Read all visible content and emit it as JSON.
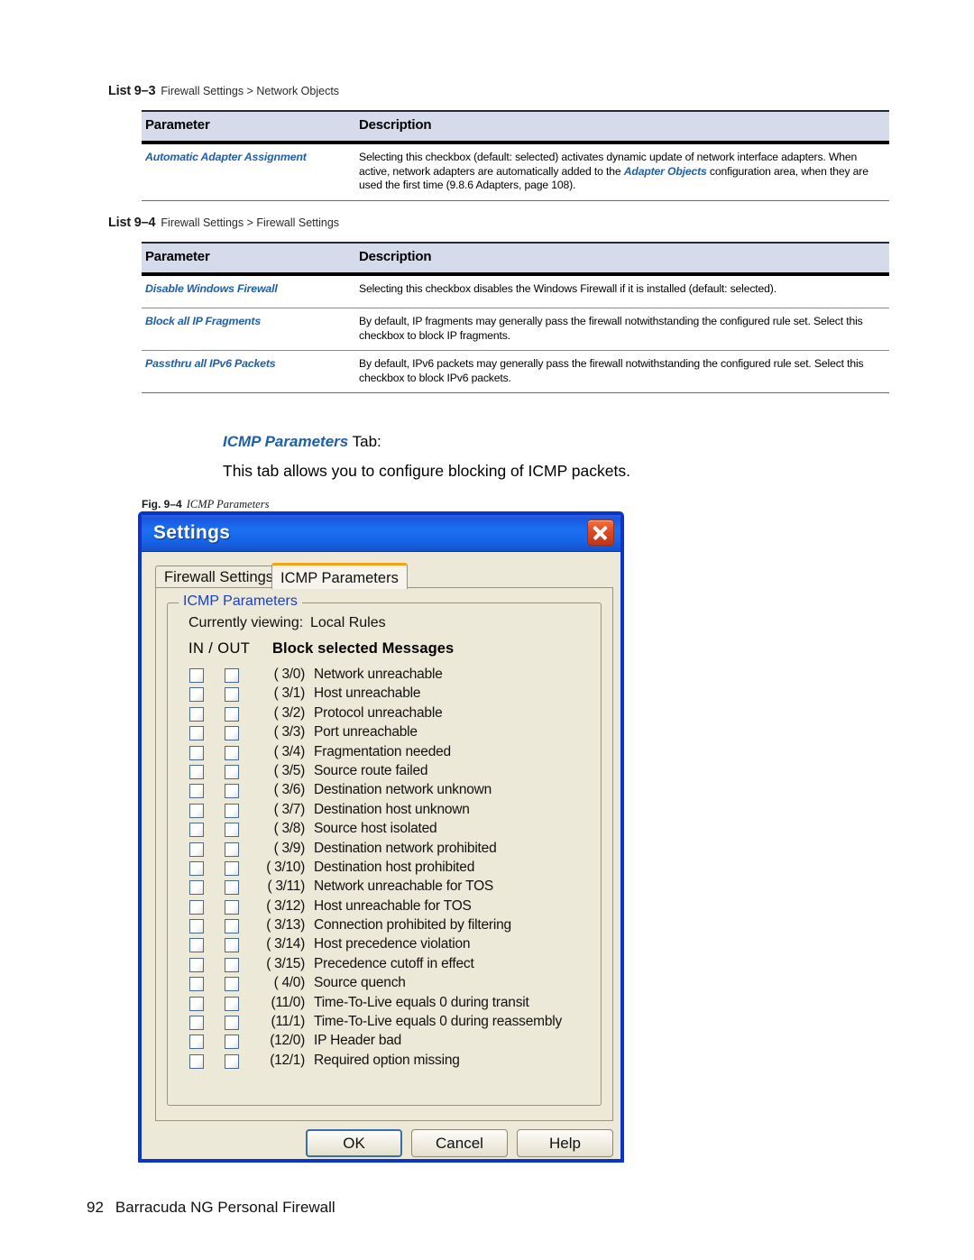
{
  "page": {
    "footer_page_number": "92",
    "footer_title": "Barracuda NG Personal Firewall"
  },
  "lists": [
    {
      "label": "List 9–3",
      "breadcrumb": "Firewall Settings > Network Objects",
      "headers": {
        "parameter": "Parameter",
        "description": "Description"
      },
      "rows": [
        {
          "parameter": "Automatic Adapter Assignment",
          "description_html": "Selecting this checkbox (default: selected) activates dynamic update of network interface adapters. When active, network adapters are automatically added to the <b class=\"blue\">Adapter Objects</b> configuration area, when they are used the first time (9.8.6 Adapters, page 108)."
        }
      ]
    },
    {
      "label": "List 9–4",
      "breadcrumb": "Firewall Settings > Firewall Settings",
      "headers": {
        "parameter": "Parameter",
        "description": "Description"
      },
      "rows": [
        {
          "parameter": "Disable Windows Firewall",
          "description_html": "Selecting this checkbox disables the Windows Firewall if it is installed (default: selected)."
        },
        {
          "parameter": "Block all IP Fragments",
          "description_html": "By default, IP fragments may generally pass the firewall notwithstanding the configured rule set. Select this checkbox to block IP fragments."
        },
        {
          "parameter": "Passthru all IPv6 Packets",
          "description_html": "By default, IPv6 packets may generally pass the firewall notwithstanding the configured rule set. Select this checkbox to block IPv6 packets."
        }
      ]
    }
  ],
  "section": {
    "tab_heading_emphasis": "ICMP Parameters",
    "tab_heading_rest": " Tab:",
    "paragraph": "This tab allows you to configure blocking of ICMP packets.",
    "figure_label": "Fig. 9–4",
    "figure_caption": "ICMP Parameters"
  },
  "dialog": {
    "title": "Settings",
    "close_icon": "close-icon",
    "tabs": [
      {
        "label": "Firewall Settings",
        "active": false
      },
      {
        "label": "ICMP Parameters",
        "active": true
      }
    ],
    "groupbox_legend": "ICMP Parameters",
    "currently_viewing_label": "Currently viewing:",
    "currently_viewing_value": "Local Rules",
    "column_header_inout": "IN / OUT",
    "column_header_block": "Block selected Messages",
    "messages": [
      {
        "code": "( 3/0)",
        "text": "Network unreachable",
        "in": false,
        "out": false
      },
      {
        "code": "( 3/1)",
        "text": "Host unreachable",
        "in": false,
        "out": false
      },
      {
        "code": "( 3/2)",
        "text": "Protocol unreachable",
        "in": false,
        "out": false
      },
      {
        "code": "( 3/3)",
        "text": "Port unreachable",
        "in": false,
        "out": false
      },
      {
        "code": "( 3/4)",
        "text": "Fragmentation needed",
        "in": false,
        "out": false
      },
      {
        "code": "( 3/5)",
        "text": "Source route failed",
        "in": false,
        "out": false
      },
      {
        "code": "( 3/6)",
        "text": "Destination network unknown",
        "in": false,
        "out": false
      },
      {
        "code": "( 3/7)",
        "text": "Destination host unknown",
        "in": false,
        "out": false
      },
      {
        "code": "( 3/8)",
        "text": "Source host isolated",
        "in": false,
        "out": false
      },
      {
        "code": "( 3/9)",
        "text": "Destination network prohibited",
        "in": false,
        "out": false
      },
      {
        "code": "( 3/10)",
        "text": "Destination host prohibited",
        "in": false,
        "out": false
      },
      {
        "code": "( 3/11)",
        "text": "Network unreachable for TOS",
        "in": false,
        "out": false
      },
      {
        "code": "( 3/12)",
        "text": "Host unreachable for TOS",
        "in": false,
        "out": false
      },
      {
        "code": "( 3/13)",
        "text": "Connection prohibited by filtering",
        "in": false,
        "out": false
      },
      {
        "code": "( 3/14)",
        "text": "Host precedence violation",
        "in": false,
        "out": false
      },
      {
        "code": "( 3/15)",
        "text": "Precedence cutoff in effect",
        "in": false,
        "out": false
      },
      {
        "code": "( 4/0)",
        "text": "Source quench",
        "in": false,
        "out": false
      },
      {
        "code": "(11/0)",
        "text": "Time-To-Live equals 0 during transit",
        "in": false,
        "out": false
      },
      {
        "code": "(11/1)",
        "text": "Time-To-Live equals 0 during reassembly",
        "in": false,
        "out": false
      },
      {
        "code": "(12/0)",
        "text": "IP Header bad",
        "in": false,
        "out": false
      },
      {
        "code": "(12/1)",
        "text": "Required option missing",
        "in": false,
        "out": false
      }
    ],
    "buttons": {
      "ok": "OK",
      "cancel": "Cancel",
      "help": "Help"
    }
  },
  "colors": {
    "link_blue": "#1f5fa9",
    "table_header_bg": "#d6dbeb",
    "titlebar_blue": "#1d6ff0",
    "tab_accent_orange": "#f5a215",
    "close_red": "#e04a22",
    "groupbox_legend_blue": "#1c3fbf"
  }
}
